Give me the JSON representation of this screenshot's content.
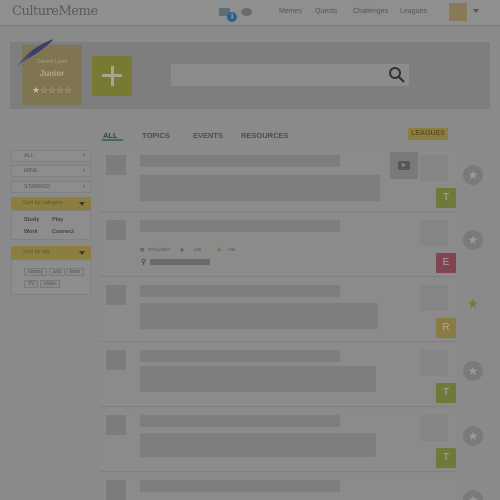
{
  "header": {
    "logo": "CultureMeme",
    "mail_badge": "1",
    "nav": [
      "Memes",
      "Quests",
      "Challenges",
      "Leagues"
    ]
  },
  "profile": {
    "caption": "Current Level",
    "level": "Junior",
    "stars": "★☆☆☆☆"
  },
  "search": {
    "placeholder": ""
  },
  "tabs": [
    "ALL",
    "TOPICS",
    "EVENTS",
    "RESOURCES"
  ],
  "leagues_button": "LEAGUES",
  "sidebar": {
    "filters": [
      "ALL",
      "MINE",
      "STARRED"
    ],
    "category_header": "Sort by category",
    "categories": [
      "Study",
      "Play",
      "Work",
      "Connect"
    ],
    "tag_header": "Sort by tag",
    "tags": [
      "history",
      "arts",
      "films",
      "TV",
      "virals"
    ]
  },
  "feed": [
    {
      "letter": "T",
      "letter_color": "#6f7a3a",
      "starred": false
    },
    {
      "letter": "E",
      "letter_color": "#804551",
      "starred": false,
      "meta": {
        "date": "07/21/2017",
        "views": "136",
        "stars": "166"
      }
    },
    {
      "letter": "R",
      "letter_color": "#8a7a44",
      "starred": true
    },
    {
      "letter": "T",
      "letter_color": "#6f7a3a",
      "starred": false
    },
    {
      "letter": "T",
      "letter_color": "#6f7a3a",
      "starred": false
    }
  ],
  "colors": {
    "accent_olive": "#8b7e40",
    "accent_green": "#466b55"
  }
}
